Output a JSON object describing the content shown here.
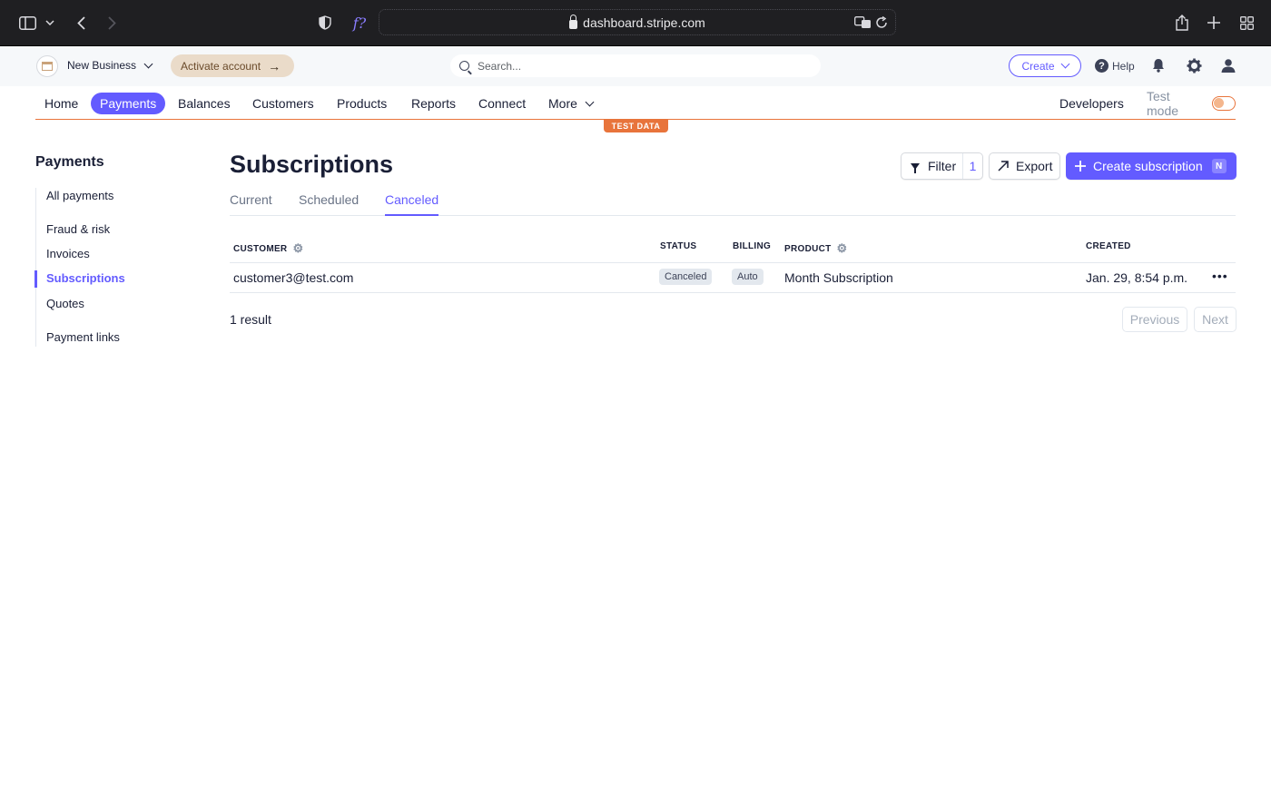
{
  "browser": {
    "url": "dashboard.stripe.com",
    "formula_icon": "f?"
  },
  "topbar": {
    "business_name": "New Business",
    "activate_label": "Activate account",
    "search_placeholder": "Search...",
    "create_label": "Create",
    "help_label": "Help",
    "help_icon_glyph": "?"
  },
  "nav": {
    "items": [
      "Home",
      "Payments",
      "Balances",
      "Customers",
      "Products",
      "Reports",
      "Connect",
      "More"
    ],
    "active": "Payments",
    "developers_label": "Developers",
    "test_mode_label": "Test mode",
    "test_data_banner": "TEST DATA"
  },
  "sidebar": {
    "title": "Payments",
    "items": [
      "All payments",
      "Fraud & risk",
      "Invoices",
      "Subscriptions",
      "Quotes",
      "Payment links"
    ],
    "active": "Subscriptions"
  },
  "main": {
    "title": "Subscriptions",
    "tabs": [
      "Current",
      "Scheduled",
      "Canceled"
    ],
    "active_tab": "Canceled",
    "filter_label": "Filter",
    "filter_count": "1",
    "export_label": "Export",
    "create_label": "Create subscription",
    "create_shortcut": "N",
    "table": {
      "headers": {
        "customer": "CUSTOMER",
        "status": "STATUS",
        "billing": "BILLING",
        "product": "PRODUCT",
        "created": "CREATED"
      },
      "rows": [
        {
          "customer": "customer3@test.com",
          "status": "Canceled",
          "billing": "Auto",
          "product": "Month Subscription",
          "created": "Jan. 29, 8:54 p.m."
        }
      ]
    },
    "result_count": "1 result",
    "previous_label": "Previous",
    "next_label": "Next"
  },
  "colors": {
    "accent": "#635bff",
    "test_mode": "#e8743b",
    "text": "#1a1f36",
    "muted": "#697386"
  }
}
